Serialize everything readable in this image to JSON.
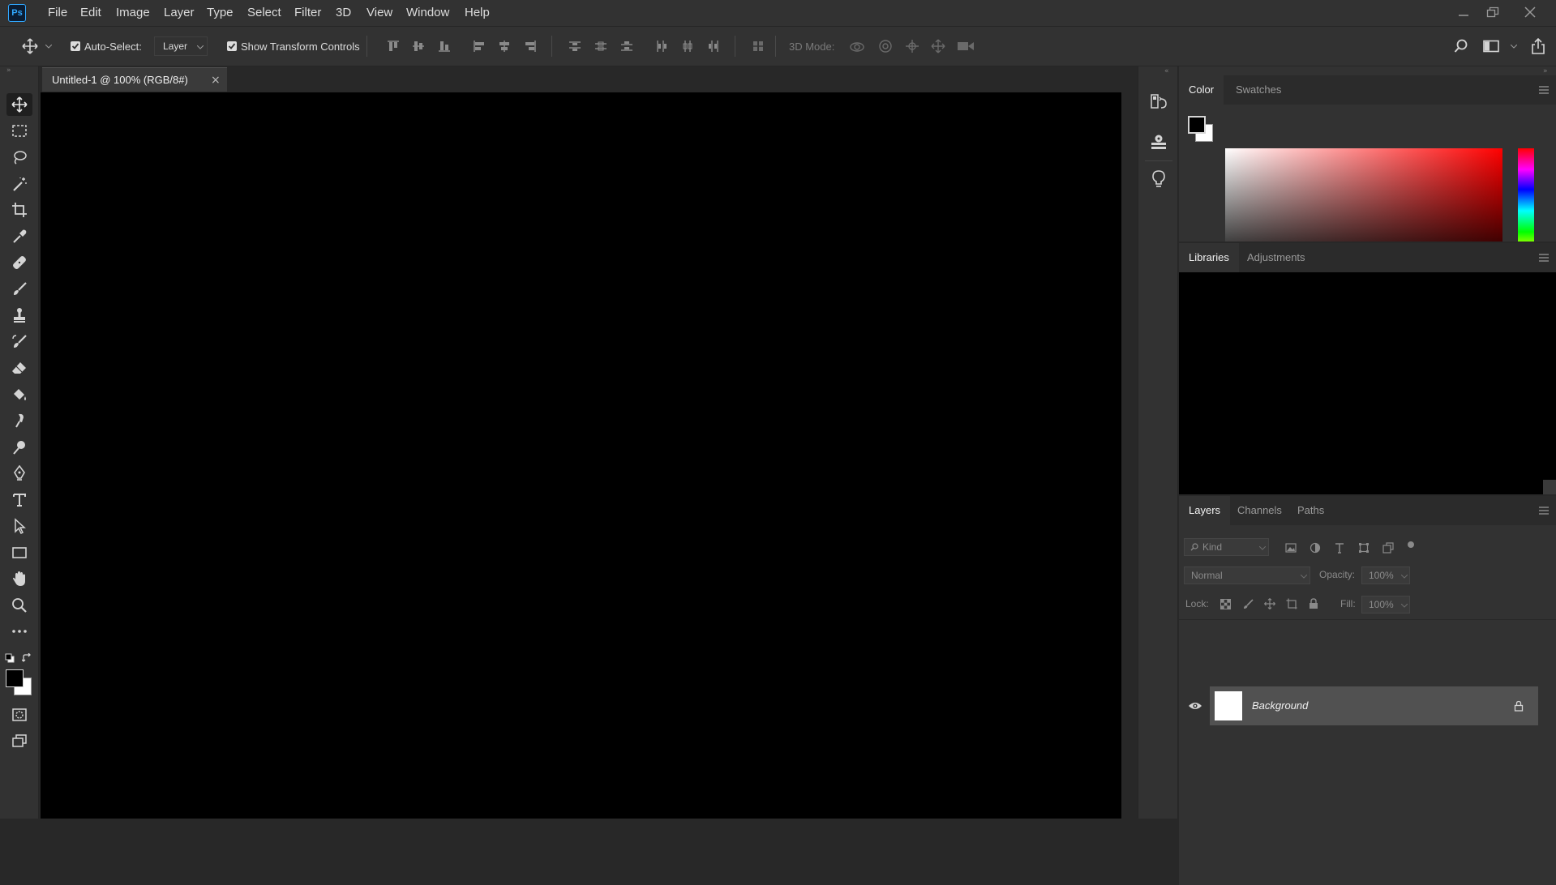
{
  "app": {
    "logo_text": "Ps"
  },
  "menu": [
    "File",
    "Edit",
    "Image",
    "Layer",
    "Type",
    "Select",
    "Filter",
    "3D",
    "View",
    "Window",
    "Help"
  ],
  "options_bar": {
    "auto_select_label": "Auto-Select:",
    "auto_select_checked": true,
    "auto_select_target": "Layer",
    "show_transform_label": "Show Transform Controls",
    "show_transform_checked": true,
    "three_d_mode_label": "3D Mode:"
  },
  "document": {
    "tab_title": "Untitled-1 @ 100% (RGB/8#)",
    "close_glyph": "×",
    "canvas_color": "#000000"
  },
  "color_panel": {
    "tabs": [
      "Color",
      "Swatches"
    ],
    "active_tab": "Color",
    "foreground": "#000000",
    "background": "#ffffff",
    "hue": "#ff0000"
  },
  "libraries_panel": {
    "tabs": [
      "Libraries",
      "Adjustments"
    ],
    "active_tab": "Libraries"
  },
  "layers_panel": {
    "tabs": [
      "Layers",
      "Channels",
      "Paths"
    ],
    "active_tab": "Layers",
    "filter_label": "Kind",
    "blend_mode": "Normal",
    "opacity_label": "Opacity:",
    "opacity_value": "100%",
    "lock_label": "Lock:",
    "fill_label": "Fill:",
    "fill_value": "100%",
    "layers": [
      {
        "name": "Background",
        "visible": true,
        "locked": true,
        "thumb_color": "#ffffff"
      }
    ]
  },
  "tools": [
    "move-tool",
    "marquee-tool",
    "lasso-tool",
    "magic-wand-tool",
    "crop-tool",
    "eyedropper-tool",
    "healing-brush-tool",
    "brush-tool",
    "clone-stamp-tool",
    "history-brush-tool",
    "eraser-tool",
    "paint-bucket-tool",
    "smudge-tool",
    "dodge-tool",
    "pen-tool",
    "type-tool",
    "path-selection-tool",
    "rectangle-tool",
    "hand-tool",
    "zoom-tool",
    "more-tools"
  ],
  "colors": {
    "accent": "#31a8ff",
    "chrome": "#323232",
    "tab_bg": "#2b2b2b"
  }
}
